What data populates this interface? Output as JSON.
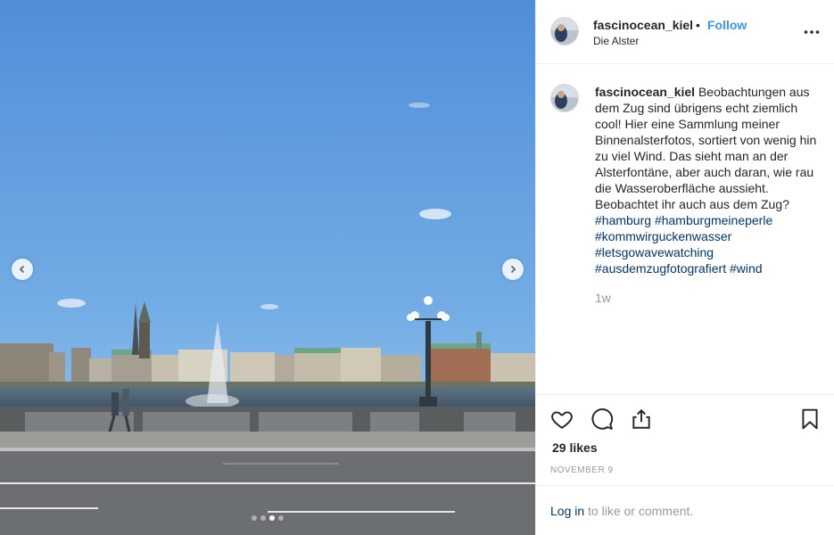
{
  "post": {
    "username": "fascinocean_kiel",
    "separator": "•",
    "follow_label": "Follow",
    "location": "Die Alster",
    "more_icon": "more-options-icon",
    "caption_username": "fascinocean_kiel",
    "caption_text": "Beobachtungen aus dem Zug sind übrigens echt ziemlich cool! Hier eine Sammlung meiner Binnenalsterfotos, sortiert von wenig hin zu viel Wind. Das sieht man an der Alsterfontäne, aber auch daran, wie rau die Wasseroberfläche aussieht. Beobachtet ihr auch aus dem Zug?",
    "hashtags": [
      "#hamburg",
      "#hamburgmeineperle",
      "#kommwirguckenwasser",
      "#letsgowavewatching",
      "#ausdemzugfotografiert",
      "#wind"
    ],
    "time_ago": "1w",
    "likes": "29 likes",
    "date": "NOVEMBER 9",
    "login_link": "Log in",
    "login_suffix": " to like or comment."
  },
  "carousel": {
    "total_slides": 4,
    "active_slide": 3,
    "prev_icon": "chevron-left-icon",
    "next_icon": "chevron-right-icon"
  },
  "colors": {
    "link_blue": "#3897f0",
    "hashtag": "#003569",
    "muted": "#999999",
    "border": "#efefef"
  }
}
